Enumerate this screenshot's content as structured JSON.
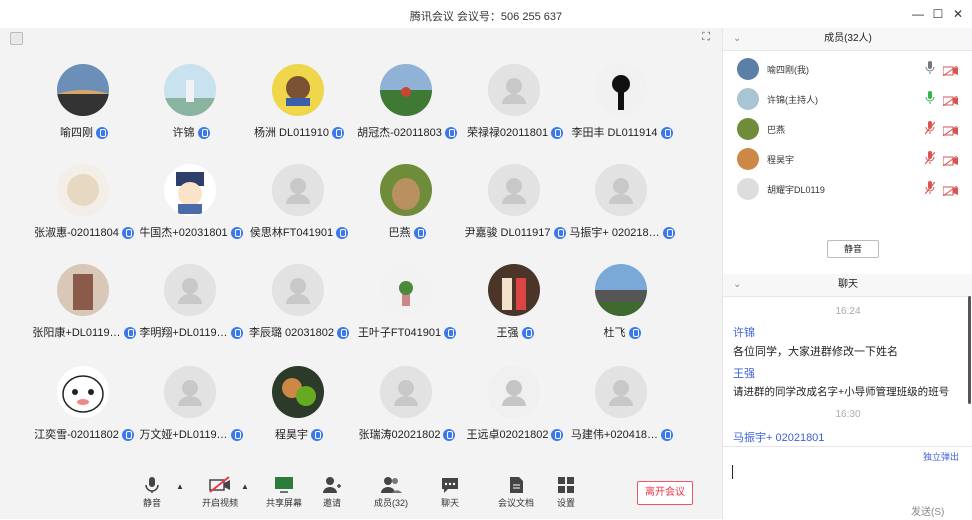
{
  "window": {
    "title": "腾讯会议 会议号：506 255 637"
  },
  "participants": [
    {
      "name": "喻四刚",
      "avatar": "photo-sky"
    },
    {
      "name": "许锦",
      "avatar": "photo-girl"
    },
    {
      "name": "杨洲 DL011910",
      "avatar": "cartoon-bear"
    },
    {
      "name": "胡冠杰-02011803",
      "avatar": "photo-field"
    },
    {
      "name": "荣禄禄02011801",
      "avatar": "generic"
    },
    {
      "name": "李田丰 DL011914",
      "avatar": "silhouette"
    },
    {
      "name": "张淑惠-02011804",
      "avatar": "photo-cake"
    },
    {
      "name": "牛国杰+02031801",
      "avatar": "cartoon-qing"
    },
    {
      "name": "侯思林FT041901",
      "avatar": "generic"
    },
    {
      "name": "巴燕",
      "avatar": "photo-cat"
    },
    {
      "name": "尹嘉骏 DL011917",
      "avatar": "generic"
    },
    {
      "name": "马振宇+ 020218…",
      "avatar": "generic"
    },
    {
      "name": "张阳康+DL0119…",
      "avatar": "photo-girl2"
    },
    {
      "name": "李明翔+DL0119…",
      "avatar": "generic"
    },
    {
      "name": "李辰璐 02031802",
      "avatar": "generic"
    },
    {
      "name": "王叶子FT041901",
      "avatar": "photo-plant"
    },
    {
      "name": "王强",
      "avatar": "photo-couple"
    },
    {
      "name": "杜飞",
      "avatar": "photo-building"
    },
    {
      "name": "江奕雪-02011802",
      "avatar": "cartoon-face"
    },
    {
      "name": "万文娅+DL0119…",
      "avatar": "generic"
    },
    {
      "name": "程昊宇",
      "avatar": "photo-painting"
    },
    {
      "name": "张瑞涛02021802",
      "avatar": "generic"
    },
    {
      "name": "王远卓02021802",
      "avatar": "generic-light"
    },
    {
      "name": "马建伟+020418…",
      "avatar": "generic"
    }
  ],
  "toolbar": {
    "mute": "静音",
    "video": "开启视频",
    "share": "共享屏幕",
    "invite": "邀请",
    "members": "成员(32)",
    "chat": "聊天",
    "docs": "会议文档",
    "settings": "设置",
    "leave": "离开会议"
  },
  "sidebar": {
    "members_header": "成员(32人)",
    "members": [
      {
        "name": "喻四刚(我)",
        "mic": "on"
      },
      {
        "name": "许锦(主持人)",
        "mic": "active"
      },
      {
        "name": "巴燕",
        "mic": "muted"
      },
      {
        "name": "程昊宇",
        "mic": "muted"
      },
      {
        "name": "胡耀宇DL0119",
        "mic": "muted"
      }
    ],
    "mute_all": "静音",
    "chat_header": "聊天",
    "messages": [
      {
        "time": "16:24"
      },
      {
        "sender": "许锦",
        "text": "各位同学，大家进群修改一下姓名"
      },
      {
        "sender": "王强",
        "text": "请进群的同学改成名字+小导师管理班级的班号"
      },
      {
        "time": "16:30"
      },
      {
        "sender": "马振宇+ 02021801"
      }
    ],
    "popout": "独立弹出",
    "send": "发送(S)"
  },
  "colors": {
    "accent": "#3b79e8",
    "leave": "#e34",
    "mic_active": "#33b54a",
    "muted": "#d9534f"
  }
}
